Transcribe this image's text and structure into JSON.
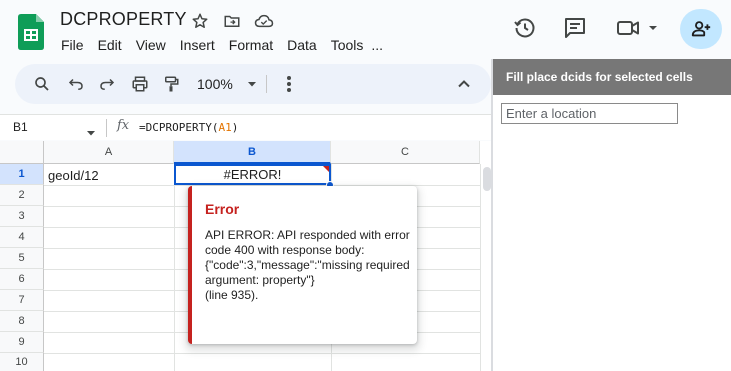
{
  "app": {
    "doc_title": "DCPROPERTY",
    "menus": [
      "File",
      "Edit",
      "View",
      "Insert",
      "Format",
      "Data",
      "Tools",
      "..."
    ]
  },
  "toolbar": {
    "zoom": "100%"
  },
  "formula_bar": {
    "name_box": "B1",
    "fx_label": "fx",
    "formula_prefix": "=DCPROPERTY(",
    "formula_ref": "A1",
    "formula_suffix": ")"
  },
  "grid": {
    "columns": [
      "A",
      "B",
      "C"
    ],
    "rows": [
      "1",
      "2",
      "3",
      "4",
      "5",
      "6",
      "7",
      "8",
      "9",
      "10"
    ],
    "selected_cell": "B1",
    "cells": {
      "A1": "geoId/12",
      "B1": "#ERROR!"
    }
  },
  "error_popup": {
    "title": "Error",
    "message": "API ERROR: API responded with error code 400 with response body:\n{\"code\":3,\"message\":\"missing required argument: property\"}\n(line 935)."
  },
  "sidebar": {
    "title": "Fill place dcids for selected cells",
    "location_placeholder": "Enter a location",
    "location_value": ""
  },
  "colors": {
    "accent": "#0b57d0",
    "error": "#c5221f",
    "share_bg": "#c2e7ff",
    "sheets_green": "#0f9d58"
  },
  "icons": [
    "sheets-logo-icon",
    "star-icon",
    "move-folder-icon",
    "cloud-icon",
    "history-icon",
    "comment-icon",
    "video-camera-icon",
    "add-person-icon",
    "search-icon",
    "undo-icon",
    "redo-icon",
    "print-icon",
    "paint-format-icon",
    "more-vert-icon",
    "chevron-up-icon"
  ]
}
